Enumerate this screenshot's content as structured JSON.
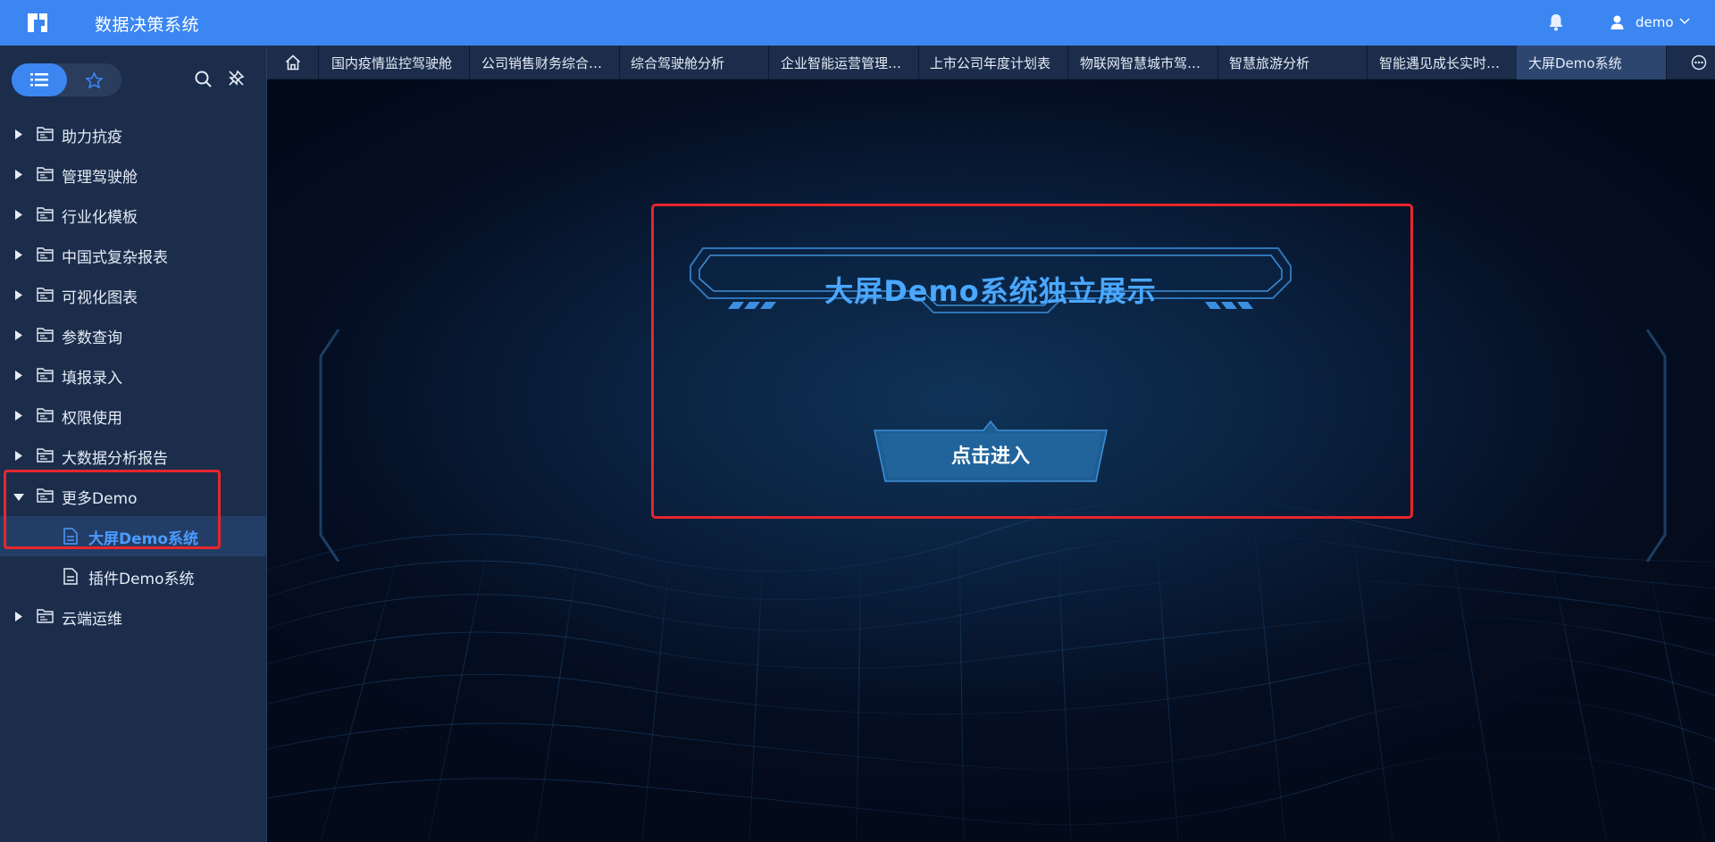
{
  "header": {
    "title": "数据决策系统",
    "username": "demo",
    "icons": [
      "logo-icon",
      "bell-icon",
      "user-icon",
      "chevron-down-icon"
    ]
  },
  "sidebar": {
    "toggle": {
      "list_icon": "list-icon",
      "favorite_icon": "star-icon"
    },
    "tools": [
      "search-icon",
      "unpin-icon"
    ],
    "items": [
      {
        "label": "助力抗疫",
        "expanded": false
      },
      {
        "label": "管理驾驶舱",
        "expanded": false
      },
      {
        "label": "行业化模板",
        "expanded": false
      },
      {
        "label": "中国式复杂报表",
        "expanded": false
      },
      {
        "label": "可视化图表",
        "expanded": false
      },
      {
        "label": "参数查询",
        "expanded": false
      },
      {
        "label": "填报录入",
        "expanded": false
      },
      {
        "label": "权限使用",
        "expanded": false
      },
      {
        "label": "大数据分析报告",
        "expanded": false
      },
      {
        "label": "更多Demo",
        "expanded": true,
        "children": [
          {
            "label": "大屏Demo系统",
            "selected": true
          },
          {
            "label": "插件Demo系统",
            "selected": false
          }
        ]
      },
      {
        "label": "云端运维",
        "expanded": false
      }
    ]
  },
  "tabs": {
    "home_icon": "home-icon",
    "items": [
      {
        "label": "国内疫情监控驾驶舱",
        "active": false
      },
      {
        "label": "公司销售财务综合…",
        "active": false
      },
      {
        "label": "综合驾驶舱分析",
        "active": false
      },
      {
        "label": "企业智能运营管理…",
        "active": false
      },
      {
        "label": "上市公司年度计划表",
        "active": false
      },
      {
        "label": "物联网智慧城市驾…",
        "active": false
      },
      {
        "label": "智慧旅游分析",
        "active": false
      },
      {
        "label": "智能遇见成长实时…",
        "active": false
      },
      {
        "label": "大屏Demo系统",
        "active": true
      }
    ],
    "more_icon": "more-icon"
  },
  "main": {
    "screen_title": "大屏Demo系统独立展示",
    "enter_button": "点击进入"
  },
  "colors": {
    "header_bg": "#3b86f1",
    "sidebar_bg": "#1b2d4b",
    "selected_text": "#4c9bff",
    "highlight_border": "#e8262b",
    "screen_title": "#4aa7ff"
  }
}
